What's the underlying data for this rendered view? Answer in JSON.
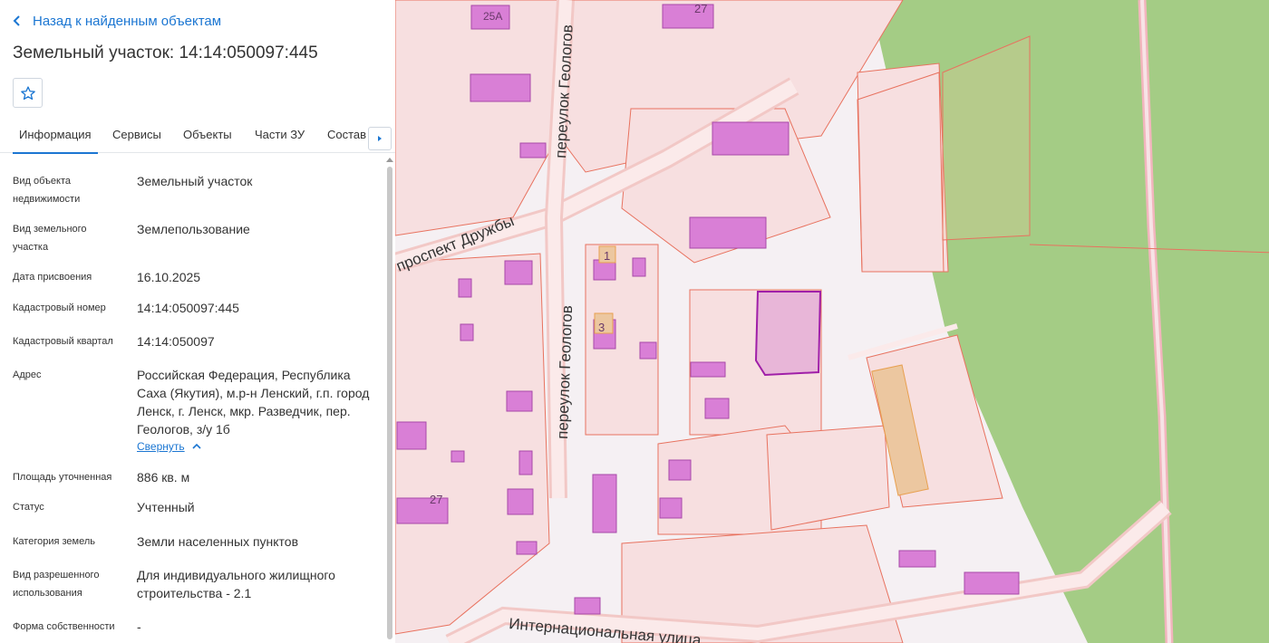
{
  "nav": {
    "back_label": "Назад к найденным объектам"
  },
  "header": {
    "title": "Земельный участок: 14:14:050097:445"
  },
  "tabs": [
    {
      "label": "Информация"
    },
    {
      "label": "Сервисы"
    },
    {
      "label": "Объекты"
    },
    {
      "label": "Части ЗУ"
    },
    {
      "label": "Состав"
    }
  ],
  "info": [
    {
      "label": "Вид объекта недвижимости",
      "value": "Земельный участок"
    },
    {
      "label": "Вид земельного участка",
      "value": "Землепользование"
    },
    {
      "label": "Дата присвоения",
      "value": "16.10.2025"
    },
    {
      "label": "Кадастровый номер",
      "value": "14:14:050097:445"
    },
    {
      "label": "Кадастровый квартал",
      "value": "14:14:050097"
    },
    {
      "label": "Адрес",
      "value": "Российская Федерация, Республика Саха (Якутия), м.р-н Ленский, г.п. город Ленск, г. Ленск, мкр. Разведчик, пер. Геологов, з/у 1б"
    },
    {
      "label": "Площадь уточненная",
      "value": "886 кв. м"
    },
    {
      "label": "Статус",
      "value": "Учтенный"
    },
    {
      "label": "Категория земель",
      "value": "Земли населенных пунктов"
    },
    {
      "label": "Вид разрешенного использования",
      "value": "Для индивидуального жилищного строительства - 2.1"
    },
    {
      "label": "Форма собственности",
      "value": "-"
    }
  ],
  "address_toggle": "Свернуть",
  "map": {
    "streets": {
      "prospekt": "проспект Дружбы",
      "pereulok_top": "переулок Геологов",
      "pereulok_mid": "переулок Геологов",
      "internatsionalnaya": "Интернациональная улица"
    },
    "house_numbers": [
      "25А",
      "27",
      "1",
      "3",
      "27"
    ],
    "colors": {
      "parcel_fill": "#f7dfe0",
      "parcel_stroke": "#e8725f",
      "building": "#d97fd6",
      "selected": "#a01fa8",
      "forest": "#a4cc85",
      "accent": "#1b76d2"
    }
  }
}
